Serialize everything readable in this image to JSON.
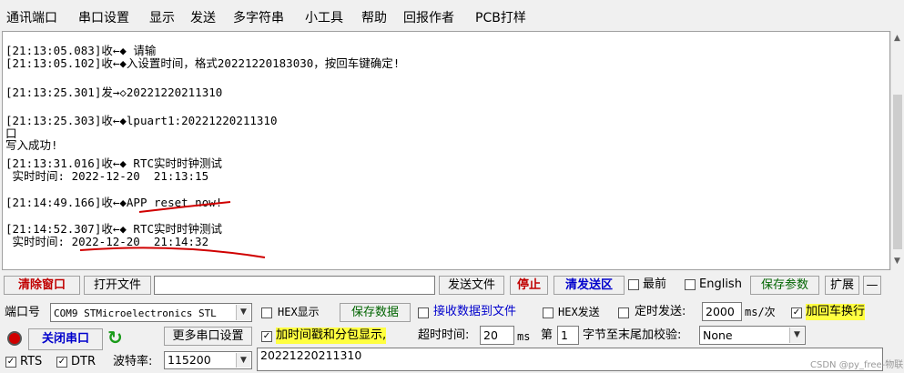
{
  "menu": [
    "通讯端口",
    "串口设置",
    "显示",
    "发送",
    "多字符串",
    "小工具",
    "帮助",
    "回报作者",
    "PCB打样"
  ],
  "terminal_lines": [
    "[21:13:05.083]收←◆ 请输",
    "[21:13:05.102]收←◆入设置时间，格式20221220183030，按回车键确定!",
    "[21:13:25.301]发→◇20221220211310",
    "[21:13:25.303]收←◆lpuart1:20221220211310",
    "口",
    "写入成功!",
    "[21:13:31.016]收←◆ RTC实时时钟测试",
    " 实时时间: 2022-12-20  21:13:15",
    "[21:14:49.166]收←◆APP reset now!",
    "[21:14:52.307]收←◆ RTC实时时钟测试",
    " 实时时间: 2022-12-20  21:14:32"
  ],
  "toolbar1": {
    "clear_window": "清除窗口",
    "open_file": "打开文件",
    "file_path": "",
    "send_file": "发送文件",
    "stop": "停止",
    "clear_send": "清发送区",
    "topmost": "最前",
    "english": "English",
    "save_params": "保存参数",
    "expand": "扩展",
    "minus": "—"
  },
  "port": {
    "label": "端口号",
    "value": "COM9 STMicroelectronics STL",
    "close_port": "关闭串口",
    "more_settings": "更多串口设置",
    "rts": "RTS",
    "dtr": "DTR",
    "baud_label": "波特率:",
    "baud_value": "115200"
  },
  "recv": {
    "hex_display": "HEX显示",
    "save_data": "保存数据",
    "recv_to_file": "接收数据到文件",
    "timestamp": "加时间戳和分包显示,",
    "timeout_label": "超时时间:",
    "timeout_value": "20",
    "ms": "ms"
  },
  "send": {
    "hex_send": "HEX发送",
    "timed_send": "定时发送:",
    "interval": "2000",
    "unit": "ms/次",
    "add_crlf": "加回车换行",
    "byte_prefix": "第",
    "byte_value": "1",
    "checksum_label": "字节至末尾加校验:",
    "checksum_value": "None",
    "input_text": "20221220211310"
  },
  "watermark": "CSDN @py_free-物联网智能家居"
}
